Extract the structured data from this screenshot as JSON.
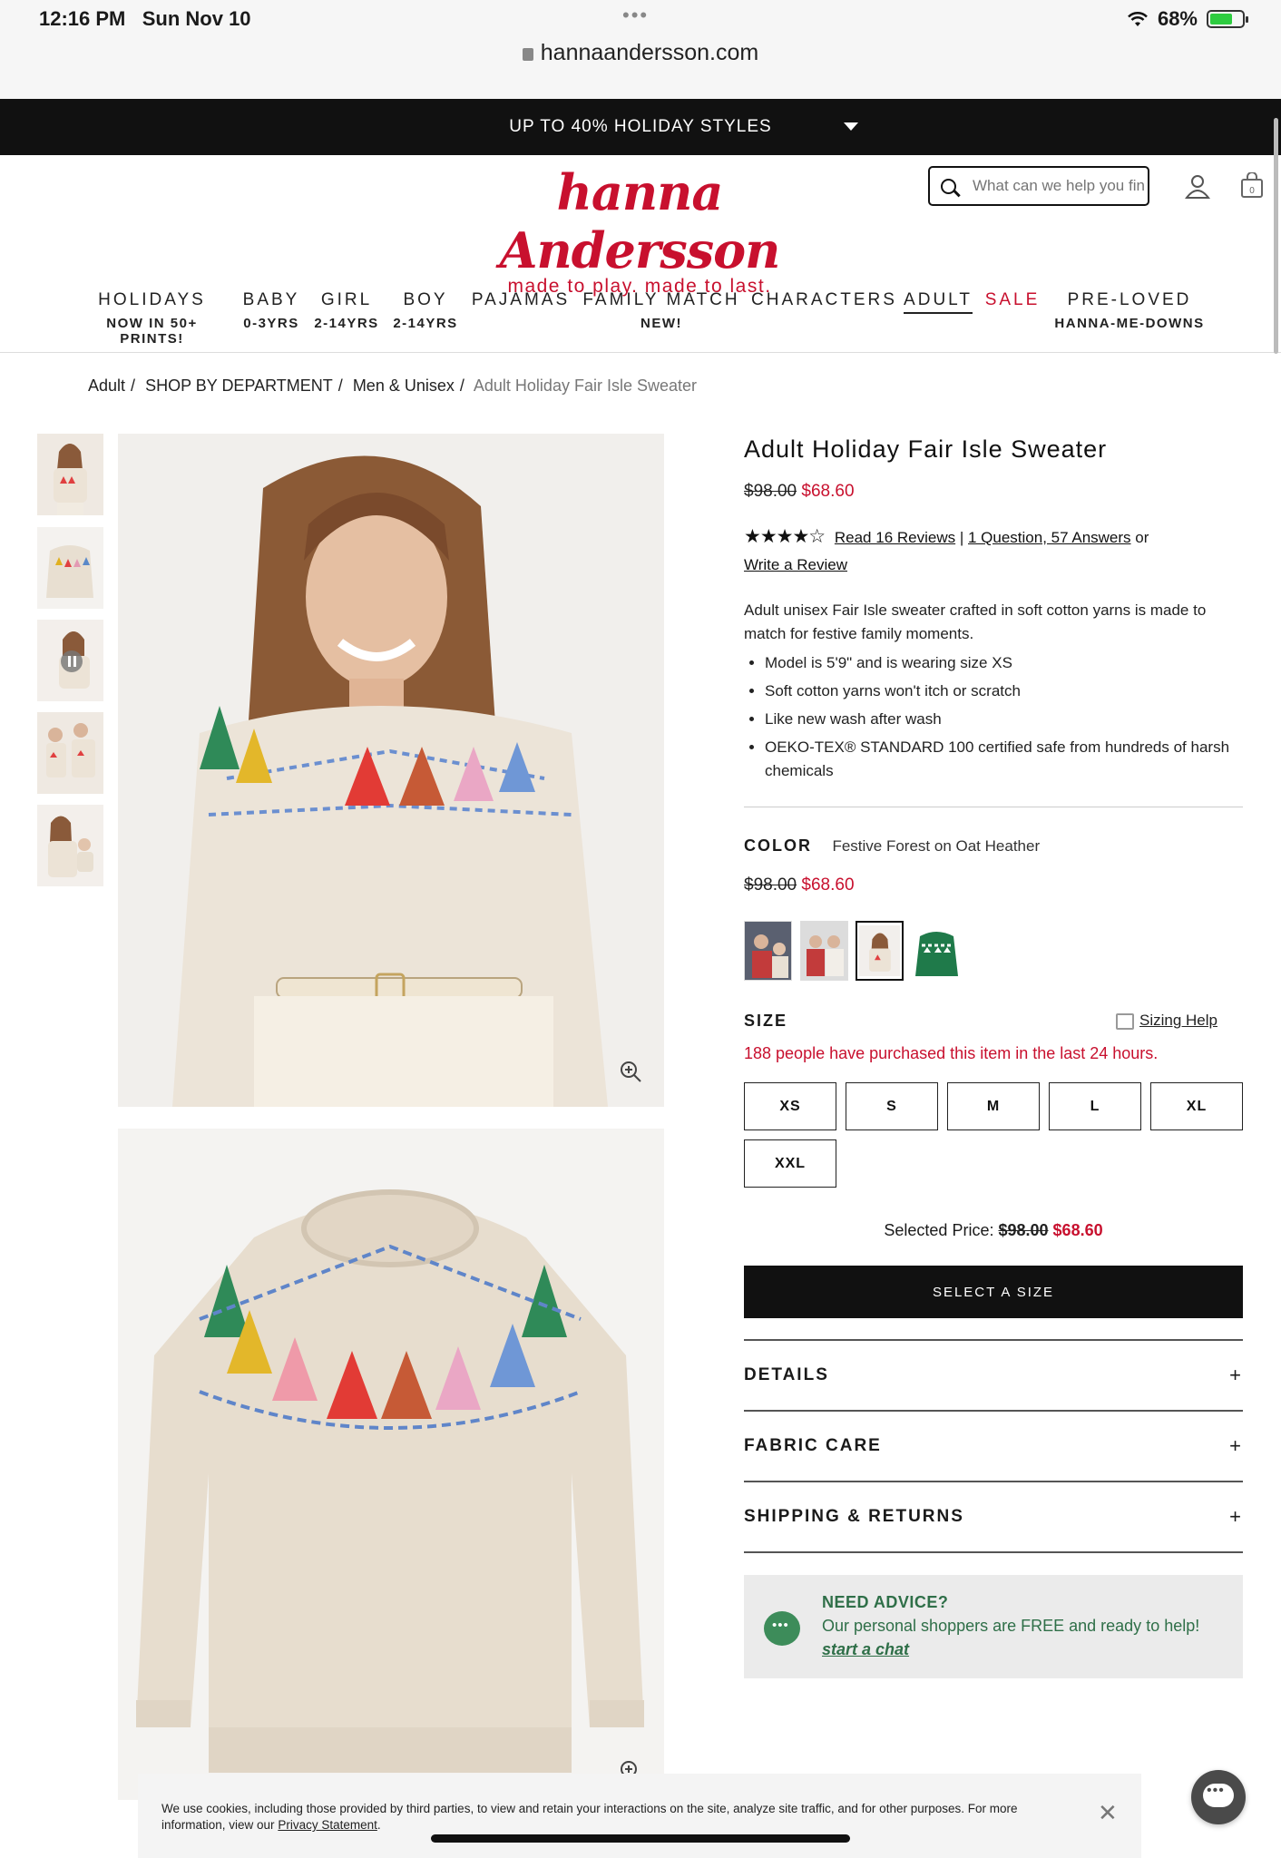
{
  "status_bar": {
    "time": "12:16 PM",
    "date": "Sun Nov 10",
    "battery": "68%"
  },
  "browser": {
    "url": "hannaandersson.com"
  },
  "promo": {
    "text": "UP TO 40% HOLIDAY STYLES"
  },
  "header": {
    "logo_text": "hannaAndersson",
    "tagline": "made to play. made to last.",
    "search_placeholder": "What can we help you find?"
  },
  "nav": [
    {
      "label": "HOLIDAYS",
      "sub": "NOW IN 50+ PRINTS!"
    },
    {
      "label": "BABY",
      "sub": "0-3YRS"
    },
    {
      "label": "GIRL",
      "sub": "2-14YRS"
    },
    {
      "label": "BOY",
      "sub": "2-14YRS"
    },
    {
      "label": "PAJAMAS",
      "sub": ""
    },
    {
      "label": "FAMILY MATCH",
      "sub": "NEW!"
    },
    {
      "label": "CHARACTERS",
      "sub": ""
    },
    {
      "label": "ADULT",
      "sub": ""
    },
    {
      "label": "SALE",
      "sub": ""
    },
    {
      "label": "PRE-LOVED",
      "sub": "HANNA-ME-DOWNS"
    }
  ],
  "breadcrumb": [
    "Adult",
    "SHOP BY DEPARTMENT",
    "Men & Unisex",
    "Adult Holiday Fair Isle Sweater"
  ],
  "product": {
    "title": "Adult Holiday Fair Isle Sweater",
    "original_price": "$98.00",
    "sale_price": "$68.60",
    "rating": 4.5,
    "stars": "★★★★☆",
    "reviews_link": "Read 16 Reviews",
    "qa_link": "1 Question, 57 Answers",
    "or": "or",
    "write_review": "Write a Review",
    "description": "Adult unisex Fair Isle sweater crafted in soft cotton yarns is made to match for festive family moments.",
    "bullets": [
      "Model is 5'9\" and is wearing size XS",
      "Soft cotton yarns won't itch or scratch",
      "Like new wash after wash",
      "OEKO-TEX® STANDARD 100 certified safe from hundreds of harsh chemicals"
    ],
    "color_label": "COLOR",
    "color_value": "Festive Forest on Oat Heather",
    "size_label": "SIZE",
    "sizing_help": "Sizing Help",
    "purchased_note": "188 people have purchased this item in the last 24 hours.",
    "sizes": [
      "XS",
      "S",
      "M",
      "L",
      "XL",
      "XXL"
    ],
    "selected_price_label": "Selected Price:",
    "cta": "SELECT A SIZE",
    "accordions": [
      "DETAILS",
      "FABRIC CARE",
      "SHIPPING & RETURNS"
    ],
    "accordion_icon": "+"
  },
  "advice": {
    "title": "NEED ADVICE?",
    "text": "Our personal shoppers are FREE and ready to help!",
    "link": "start a chat"
  },
  "cookie": {
    "text": "We use cookies, including those provided by third parties, to view and retain your interactions on the site, analyze site traffic, and for other purposes. For more information, view our",
    "link": "Privacy Statement",
    "close": "✕"
  },
  "colors": {
    "brand_red": "#c8102e",
    "advice_green": "#2f6f48",
    "promo_bg": "#111111"
  }
}
